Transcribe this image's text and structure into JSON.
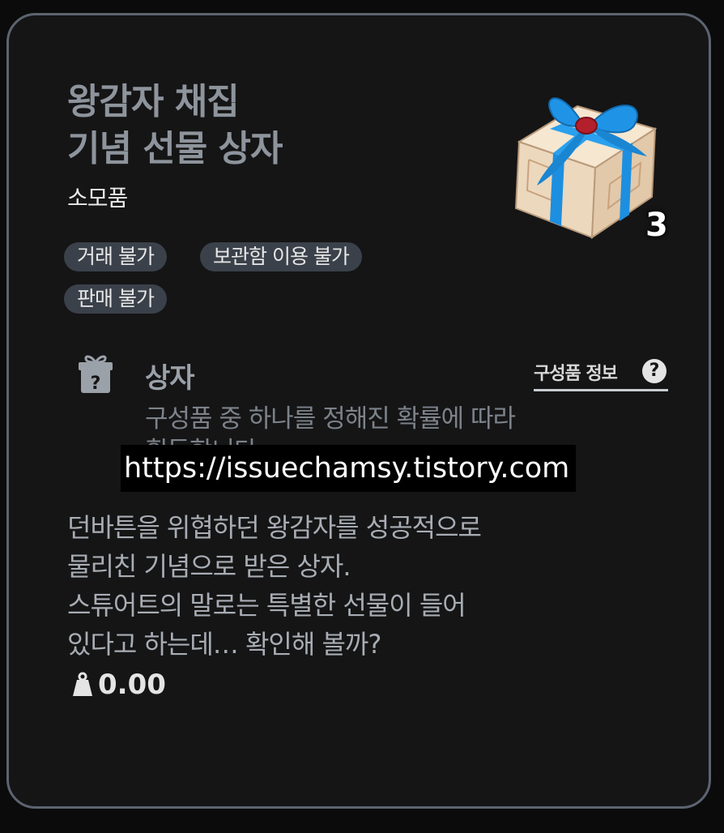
{
  "item": {
    "title_line1": "왕감자 채집",
    "title_line2": "기념 선물 상자",
    "category": "소모품",
    "count": "3",
    "icon": "gift-box-icon"
  },
  "tags": [
    {
      "label": "거래 불가"
    },
    {
      "label": "보관함 이용 불가"
    },
    {
      "label": "판매 불가"
    }
  ],
  "box_section": {
    "label": "상자",
    "icon": "gift-box-question-icon",
    "components_link": "구성품 정보",
    "help_icon": "question-icon",
    "description_line1": "구성품 중 하나를 정해진 확률에 따라",
    "description_line2": "획득합니다."
  },
  "watermark": "https://issuechamsy.tistory.com",
  "lore": {
    "line1": "던바튼을 위협하던 왕감자를 성공적으로",
    "line2": "물리친 기념으로 받은 상자.",
    "line3": "스튜어트의 말로는 특별한 선물이 들어",
    "line4": "있다고 하는데… 확인해 볼까?"
  },
  "weight": {
    "value": "0.00",
    "icon": "weight-icon"
  },
  "colors": {
    "card_bg": "#151516",
    "card_border": "#5c6470",
    "tag_bg": "#3b414a",
    "ribbon_blue": "#1d8fe0",
    "box_beige": "#efdcc3"
  }
}
